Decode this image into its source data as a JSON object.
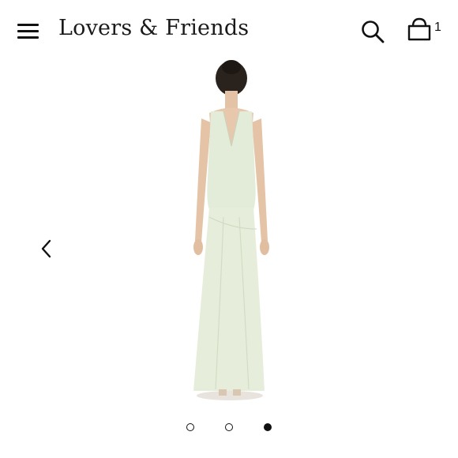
{
  "header": {
    "menu_icon": "hamburger-menu-icon",
    "brand": "Lovers & Friends",
    "search_icon": "search-icon",
    "cart_icon": "shopping-bag-icon",
    "cart_count": "1"
  },
  "gallery": {
    "prev_icon": "chevron-left-icon",
    "image_description_icon": "dress-back-view",
    "dress_color": "#e3ecd8",
    "slides_total": 3,
    "active_slide": 3
  }
}
